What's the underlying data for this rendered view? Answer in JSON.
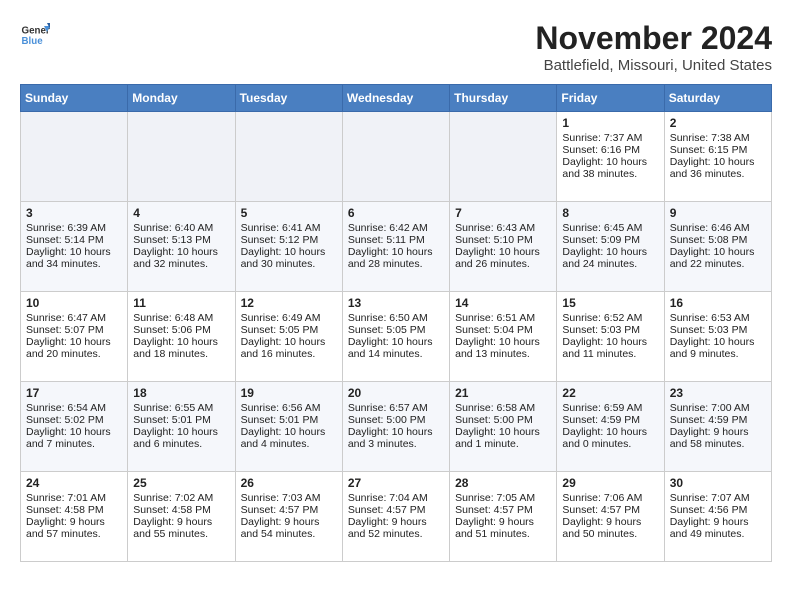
{
  "header": {
    "logo_line1": "General",
    "logo_line2": "Blue",
    "title": "November 2024",
    "subtitle": "Battlefield, Missouri, United States"
  },
  "weekdays": [
    "Sunday",
    "Monday",
    "Tuesday",
    "Wednesday",
    "Thursday",
    "Friday",
    "Saturday"
  ],
  "weeks": [
    [
      {
        "day": "",
        "text": ""
      },
      {
        "day": "",
        "text": ""
      },
      {
        "day": "",
        "text": ""
      },
      {
        "day": "",
        "text": ""
      },
      {
        "day": "",
        "text": ""
      },
      {
        "day": "1",
        "text": "Sunrise: 7:37 AM\nSunset: 6:16 PM\nDaylight: 10 hours and 38 minutes."
      },
      {
        "day": "2",
        "text": "Sunrise: 7:38 AM\nSunset: 6:15 PM\nDaylight: 10 hours and 36 minutes."
      }
    ],
    [
      {
        "day": "3",
        "text": "Sunrise: 6:39 AM\nSunset: 5:14 PM\nDaylight: 10 hours and 34 minutes."
      },
      {
        "day": "4",
        "text": "Sunrise: 6:40 AM\nSunset: 5:13 PM\nDaylight: 10 hours and 32 minutes."
      },
      {
        "day": "5",
        "text": "Sunrise: 6:41 AM\nSunset: 5:12 PM\nDaylight: 10 hours and 30 minutes."
      },
      {
        "day": "6",
        "text": "Sunrise: 6:42 AM\nSunset: 5:11 PM\nDaylight: 10 hours and 28 minutes."
      },
      {
        "day": "7",
        "text": "Sunrise: 6:43 AM\nSunset: 5:10 PM\nDaylight: 10 hours and 26 minutes."
      },
      {
        "day": "8",
        "text": "Sunrise: 6:45 AM\nSunset: 5:09 PM\nDaylight: 10 hours and 24 minutes."
      },
      {
        "day": "9",
        "text": "Sunrise: 6:46 AM\nSunset: 5:08 PM\nDaylight: 10 hours and 22 minutes."
      }
    ],
    [
      {
        "day": "10",
        "text": "Sunrise: 6:47 AM\nSunset: 5:07 PM\nDaylight: 10 hours and 20 minutes."
      },
      {
        "day": "11",
        "text": "Sunrise: 6:48 AM\nSunset: 5:06 PM\nDaylight: 10 hours and 18 minutes."
      },
      {
        "day": "12",
        "text": "Sunrise: 6:49 AM\nSunset: 5:05 PM\nDaylight: 10 hours and 16 minutes."
      },
      {
        "day": "13",
        "text": "Sunrise: 6:50 AM\nSunset: 5:05 PM\nDaylight: 10 hours and 14 minutes."
      },
      {
        "day": "14",
        "text": "Sunrise: 6:51 AM\nSunset: 5:04 PM\nDaylight: 10 hours and 13 minutes."
      },
      {
        "day": "15",
        "text": "Sunrise: 6:52 AM\nSunset: 5:03 PM\nDaylight: 10 hours and 11 minutes."
      },
      {
        "day": "16",
        "text": "Sunrise: 6:53 AM\nSunset: 5:03 PM\nDaylight: 10 hours and 9 minutes."
      }
    ],
    [
      {
        "day": "17",
        "text": "Sunrise: 6:54 AM\nSunset: 5:02 PM\nDaylight: 10 hours and 7 minutes."
      },
      {
        "day": "18",
        "text": "Sunrise: 6:55 AM\nSunset: 5:01 PM\nDaylight: 10 hours and 6 minutes."
      },
      {
        "day": "19",
        "text": "Sunrise: 6:56 AM\nSunset: 5:01 PM\nDaylight: 10 hours and 4 minutes."
      },
      {
        "day": "20",
        "text": "Sunrise: 6:57 AM\nSunset: 5:00 PM\nDaylight: 10 hours and 3 minutes."
      },
      {
        "day": "21",
        "text": "Sunrise: 6:58 AM\nSunset: 5:00 PM\nDaylight: 10 hours and 1 minute."
      },
      {
        "day": "22",
        "text": "Sunrise: 6:59 AM\nSunset: 4:59 PM\nDaylight: 10 hours and 0 minutes."
      },
      {
        "day": "23",
        "text": "Sunrise: 7:00 AM\nSunset: 4:59 PM\nDaylight: 9 hours and 58 minutes."
      }
    ],
    [
      {
        "day": "24",
        "text": "Sunrise: 7:01 AM\nSunset: 4:58 PM\nDaylight: 9 hours and 57 minutes."
      },
      {
        "day": "25",
        "text": "Sunrise: 7:02 AM\nSunset: 4:58 PM\nDaylight: 9 hours and 55 minutes."
      },
      {
        "day": "26",
        "text": "Sunrise: 7:03 AM\nSunset: 4:57 PM\nDaylight: 9 hours and 54 minutes."
      },
      {
        "day": "27",
        "text": "Sunrise: 7:04 AM\nSunset: 4:57 PM\nDaylight: 9 hours and 52 minutes."
      },
      {
        "day": "28",
        "text": "Sunrise: 7:05 AM\nSunset: 4:57 PM\nDaylight: 9 hours and 51 minutes."
      },
      {
        "day": "29",
        "text": "Sunrise: 7:06 AM\nSunset: 4:57 PM\nDaylight: 9 hours and 50 minutes."
      },
      {
        "day": "30",
        "text": "Sunrise: 7:07 AM\nSunset: 4:56 PM\nDaylight: 9 hours and 49 minutes."
      }
    ]
  ]
}
